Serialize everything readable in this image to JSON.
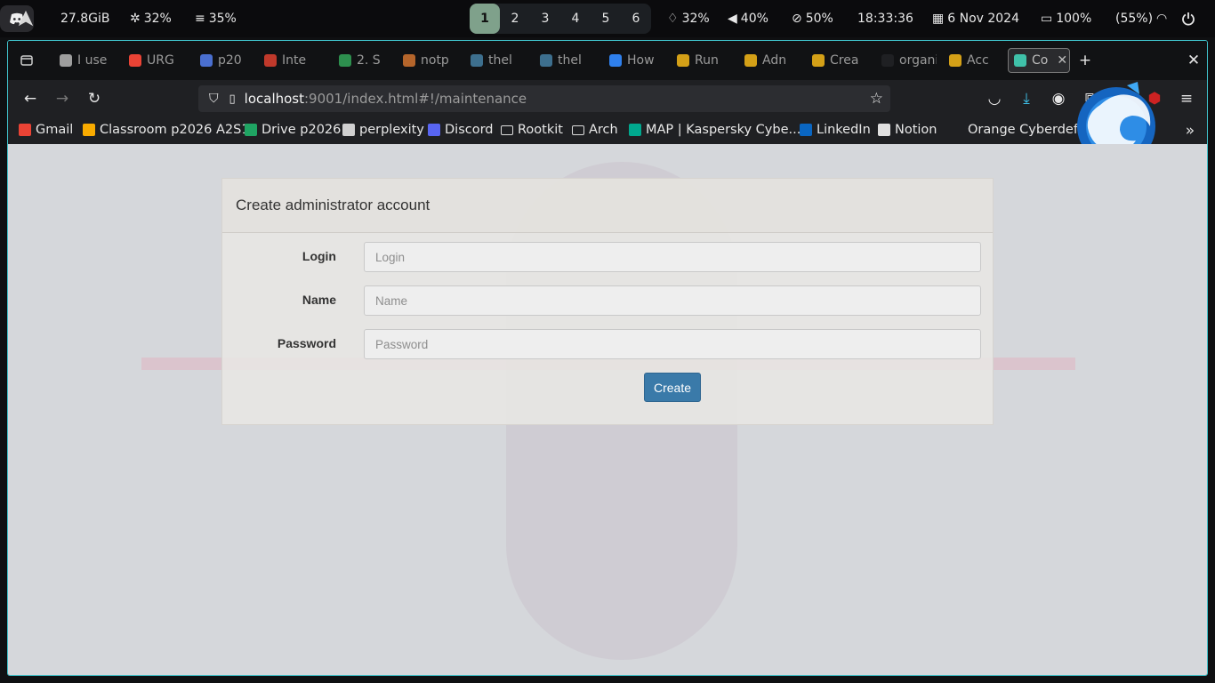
{
  "sysbar": {
    "memory": "27.8GiB",
    "cpu": "32%",
    "disk": "35%",
    "workspaces": [
      "1",
      "2",
      "3",
      "4",
      "5",
      "6"
    ],
    "active_workspace": "1",
    "brightness": "32%",
    "volume": "40%",
    "mic": "50%",
    "time": "18:33:36",
    "date": "6 Nov 2024",
    "battery": "100%",
    "wifi": "(55%)"
  },
  "tabs": [
    {
      "label": "I use",
      "color": "#9e9e9e"
    },
    {
      "label": "URG",
      "color": "#ea4335"
    },
    {
      "label": "p20",
      "color": "#4a6fd0"
    },
    {
      "label": "Inte",
      "color": "#c0392b"
    },
    {
      "label": "2. S",
      "color": "#2d8f4e"
    },
    {
      "label": "notp",
      "color": "#b5652b"
    },
    {
      "label": "thel",
      "color": "#3d6f8e"
    },
    {
      "label": "thel",
      "color": "#3d6f8e"
    },
    {
      "label": "How",
      "color": "#2f80ed"
    },
    {
      "label": "Run",
      "color": "#d4a017"
    },
    {
      "label": "Adn",
      "color": "#d4a017"
    },
    {
      "label": "Crea",
      "color": "#d4a017"
    },
    {
      "label": "organis",
      "color": "#1f2023"
    },
    {
      "label": "Acc",
      "color": "#d4a017"
    },
    {
      "label": "Co",
      "color": "#3fc1a9"
    }
  ],
  "url": {
    "host": "localhost",
    "rest": ":9001/index.html#!/maintenance"
  },
  "bookmarks": [
    {
      "label": "Gmail",
      "color": "#ea4335"
    },
    {
      "label": "Classroom p2026 A2S1",
      "color": "#f9ab00"
    },
    {
      "label": "Drive p2026",
      "color": "#1fa463"
    },
    {
      "label": "perplexity",
      "color": "#d0d0d0"
    },
    {
      "label": "Discord",
      "color": "#5865f2"
    },
    {
      "label": "Rootkit",
      "color": "#00000000"
    },
    {
      "label": "Arch",
      "color": "#00000000"
    },
    {
      "label": "MAP | Kaspersky Cybe...",
      "color": "#00a88e"
    },
    {
      "label": "LinkedIn",
      "color": "#0a66c2"
    },
    {
      "label": "Notion",
      "color": "#e0e0e0"
    },
    {
      "label": "Orange Cyberdefense ...",
      "color": "#00000000"
    }
  ],
  "form": {
    "heading": "Create administrator account",
    "login_label": "Login",
    "login_placeholder": "Login",
    "name_label": "Name",
    "name_placeholder": "Name",
    "password_label": "Password",
    "password_placeholder": "Password",
    "submit_label": "Create"
  }
}
